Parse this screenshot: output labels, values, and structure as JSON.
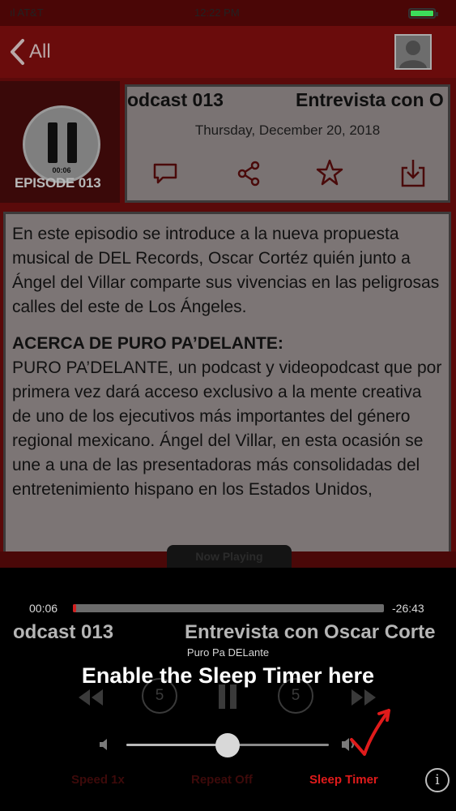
{
  "status_bar": {
    "carrier": "ıl AT&T",
    "time": "12:22 PM"
  },
  "nav": {
    "back_label": "All"
  },
  "episode": {
    "cover_time": "00:06",
    "cover_label": "EPISODE 013",
    "title_left": "odcast 013",
    "title_right": "Entrevista con O",
    "date": "Thursday, December 20, 2018",
    "action_icons": [
      "comment-icon",
      "share-icon",
      "star-icon",
      "download-icon"
    ]
  },
  "description": {
    "intro": "En este episodio se introduce a la nueva propuesta musical de DEL Records, Oscar Cortéz quién junto a Ángel del Villar comparte sus vivencias en las peligrosas calles del este de Los Ángeles.",
    "about_heading": "ACERCA DE PURO PA’DELANTE:",
    "about_text": "PURO PA’DELANTE, un podcast y videopodcast que por primera vez dará acceso exclusivo a la mente creativa de uno de los ejecutivos más importantes del género regional mexicano. Ángel del Villar, en esta ocasión se une a una de las presentadoras más consolidadas del entretenimiento hispano en los Estados Unidos,"
  },
  "player": {
    "tab_label": "Now Playing",
    "elapsed": "00:06",
    "remaining": "-26:43",
    "progress_fraction": 0.006,
    "title_left": "odcast 013",
    "title_right": "Entrevista con Oscar Corte",
    "artist": "Puro Pa DELante",
    "skip_back_seconds": "5",
    "skip_forward_seconds": "5",
    "callout": "Enable the Sleep Timer here",
    "volume_fraction": 0.5,
    "speed_label": "Speed 1x",
    "repeat_label": "Repeat Off",
    "sleep_label": "Sleep Timer",
    "info_label": "i"
  },
  "colors": {
    "accent_red": "#d31e1e",
    "annotation_red": "#e01b1b",
    "speed_text": "#3d0a0a",
    "repeat_text": "#3d0a0a"
  }
}
